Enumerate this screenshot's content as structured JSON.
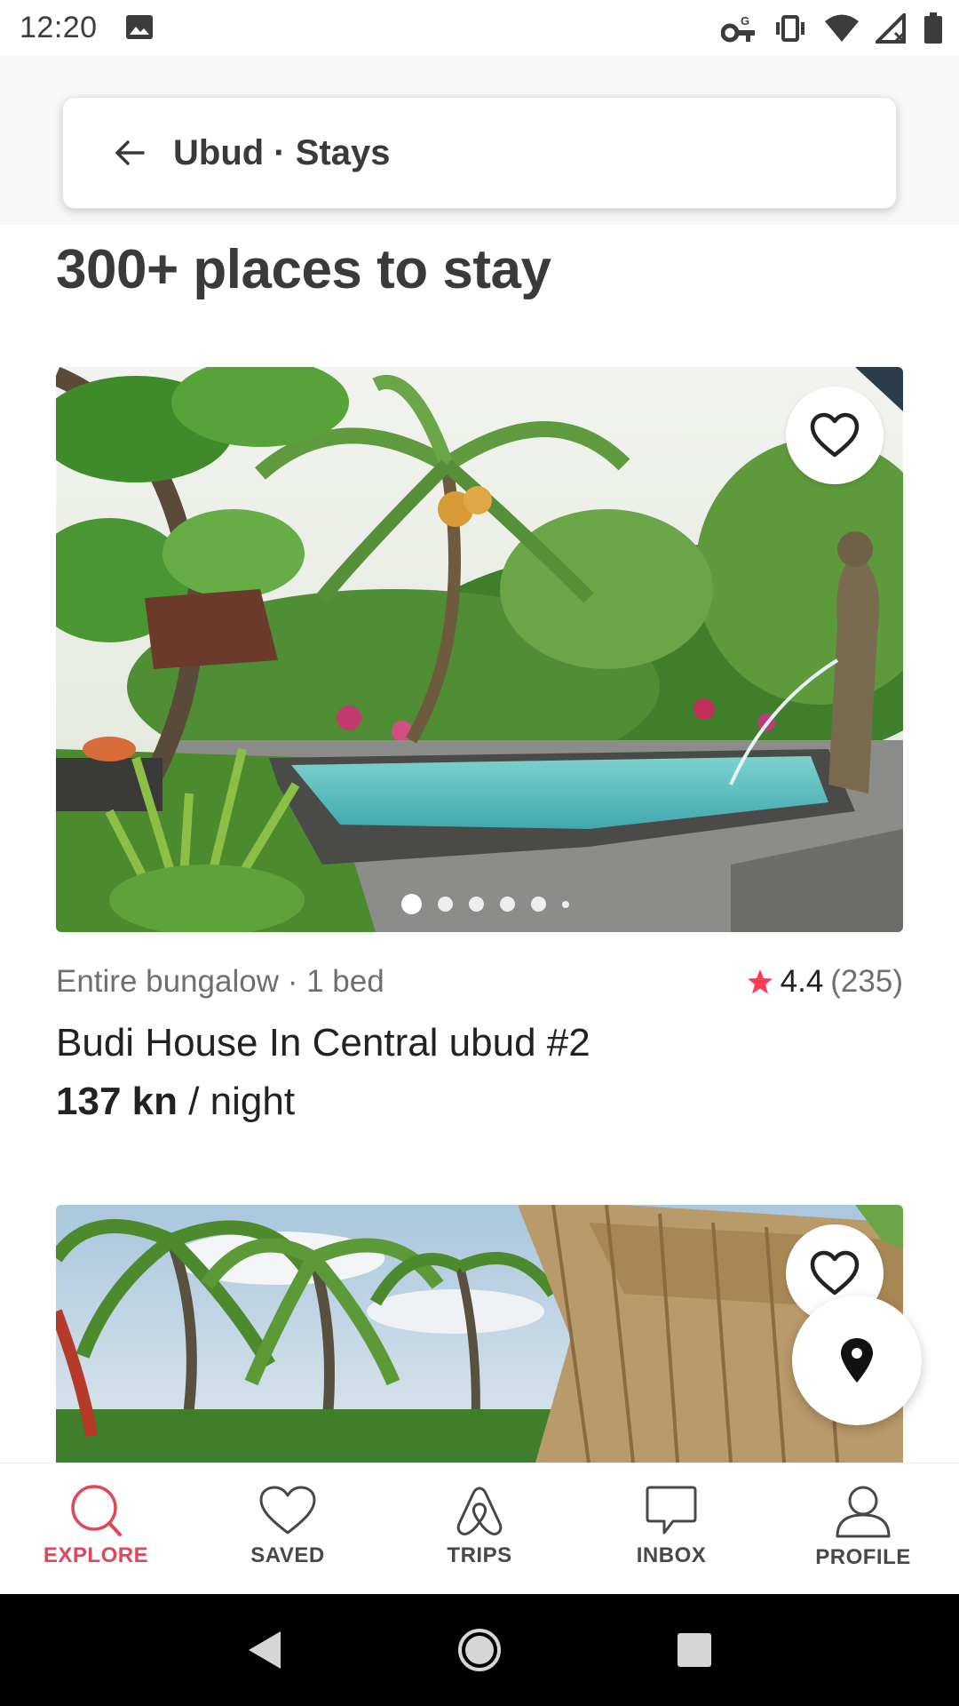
{
  "status_bar": {
    "time": "12:20",
    "icons": [
      "image-icon",
      "vpn-key-icon",
      "vibrate-icon",
      "wifi-icon",
      "signal-icon",
      "battery-icon"
    ]
  },
  "search": {
    "back_icon": "arrow-left-icon",
    "text": "Ubud · Stays"
  },
  "results": {
    "title": "300+ places to stay"
  },
  "listings": [
    {
      "type": "Entire bungalow · 1 bed",
      "rating": "4.4",
      "review_count": "(235)",
      "title": "Budi House In Central ubud #2",
      "price": "137 kn",
      "price_unit": " / night",
      "photo_count_dots": 6,
      "active_photo": 0
    },
    {
      "type": "",
      "title": ""
    }
  ],
  "colors": {
    "accent": "#e0485a",
    "star": "#ff385c",
    "text_dark": "#222222",
    "text_muted": "#6f6f6f"
  },
  "bottom_nav": [
    {
      "label": "EXPLORE",
      "icon": "search-icon",
      "active": true
    },
    {
      "label": "SAVED",
      "icon": "heart-icon",
      "active": false
    },
    {
      "label": "TRIPS",
      "icon": "airbnb-logo-icon",
      "active": false
    },
    {
      "label": "INBOX",
      "icon": "message-icon",
      "active": false
    },
    {
      "label": "PROFILE",
      "icon": "user-icon",
      "active": false
    }
  ],
  "system_nav": [
    "back-icon",
    "home-icon",
    "recents-icon"
  ]
}
